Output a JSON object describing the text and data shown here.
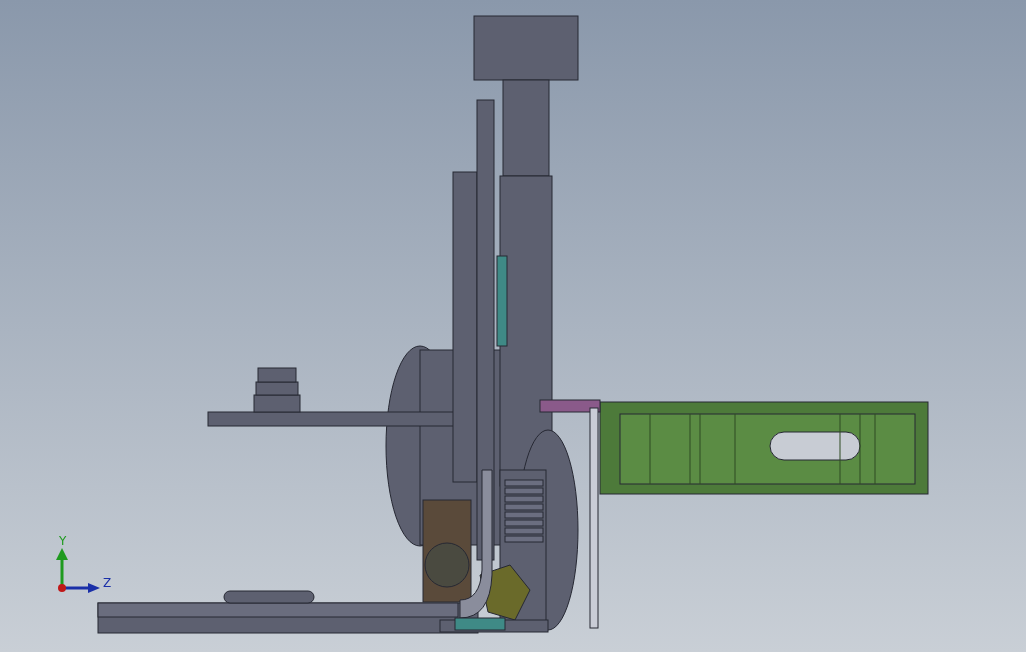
{
  "viewport": {
    "triad": {
      "axes": [
        {
          "label": "Y",
          "color": "#1f9a1f"
        },
        {
          "label": "Z",
          "color": "#1a2fa8"
        }
      ]
    }
  }
}
